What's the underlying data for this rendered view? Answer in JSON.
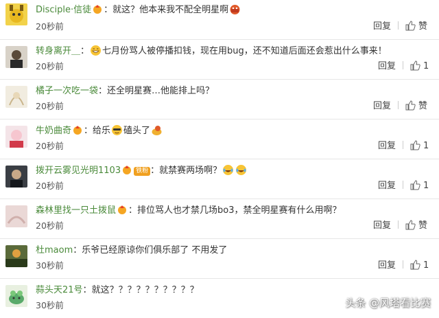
{
  "ui": {
    "reply_label": "回复",
    "like_label": "赞"
  },
  "comments": [
    {
      "user": "Disciple·信徒",
      "sep": "：",
      "text": "就这？他本来我不配全明星啊",
      "time": "20秒前",
      "like_count": ""
    },
    {
      "user": "转身离开＿",
      "sep": "：",
      "text": "七月份骂人被停播扣钱，现在用bug，还不知道后面还会惹出什么事来！",
      "time": "20秒前",
      "like_count": "1"
    },
    {
      "user": "橘子一次吃一袋",
      "sep": "：",
      "text": "还全明星赛…他能排上吗？",
      "time": "20秒前",
      "like_count": ""
    },
    {
      "user": "牛奶曲奇",
      "sep": "：",
      "text": "给乐",
      "text2": "磕头了",
      "time": "20秒前",
      "like_count": "1"
    },
    {
      "user": "拨开云雾见光明1103",
      "vip": "铁粉",
      "sep": "：",
      "text": "就禁赛两场啊？",
      "time": "20秒前",
      "like_count": "1"
    },
    {
      "user": "森林里找一只土拨鼠",
      "sep": "：",
      "text": "排位骂人也才禁几场bo3，禁全明星赛有什么用啊？",
      "time": "20秒前",
      "like_count": ""
    },
    {
      "user": "杜maom",
      "sep": "：",
      "text": "乐爷已经原谅你们俱乐部了 不用发了",
      "time": "30秒前",
      "like_count": "1"
    },
    {
      "user": "蒜头天21号",
      "sep": "：",
      "text": "就这？？？？？？？？？？",
      "time": "30秒前",
      "like_count": ""
    }
  ],
  "watermark": "头条 @风塔看比赛",
  "colors": {
    "username": "#4a8a3a",
    "divider": "#e6e6e6",
    "text": "#333333"
  }
}
